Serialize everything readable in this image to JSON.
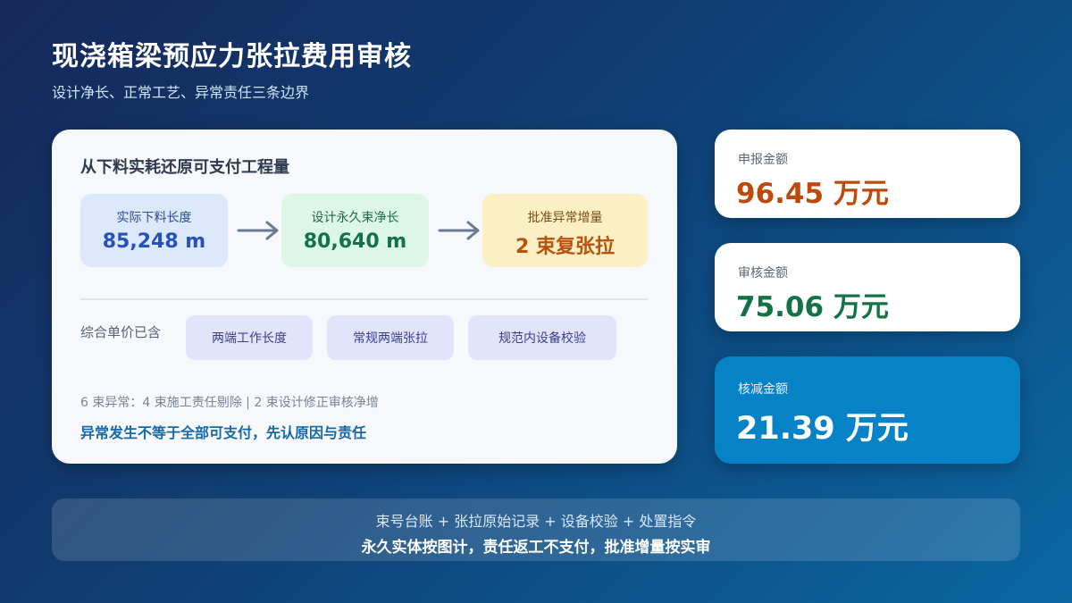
{
  "header": {
    "title": "现浇箱梁预应力张拉费用审核",
    "subtitle": "设计净长、正常工艺、异常责任三条边界"
  },
  "main": {
    "heading": "从下料实耗还原可支付工程量",
    "steps": [
      {
        "label": "实际下料长度",
        "value": "85,248 m"
      },
      {
        "label": "设计永久束净长",
        "value": "80,640 m"
      },
      {
        "label": "批准异常增量",
        "value": "2 束复张拉"
      }
    ],
    "included_label": "综合单价已含",
    "included_items": [
      "两端工作长度",
      "常规两端张拉",
      "规范内设备校验"
    ],
    "note": "6 束异常：4 束施工责任剔除 | 2 束设计修正审核净增",
    "emphasis": "异常发生不等于全部可支付，先认原因与责任"
  },
  "amounts": {
    "declared": {
      "label": "申报金额",
      "value": "96.45 万元"
    },
    "audited": {
      "label": "审核金额",
      "value": "75.06 万元"
    },
    "reduction": {
      "label": "核减金额",
      "value": "21.39 万元"
    }
  },
  "footer": {
    "line1": "束号台账 + 张拉原始记录 + 设备校验 + 处置指令",
    "line2": "永久实体按图计，责任返工不支付，批准增量按实审"
  },
  "icons": {
    "flow_arrow": "arrow-right-icon"
  },
  "colors": {
    "declared": "#bd4a0d",
    "audited": "#117346",
    "reduction_bg": "#0583c6",
    "emphasis": "#1668a8"
  }
}
